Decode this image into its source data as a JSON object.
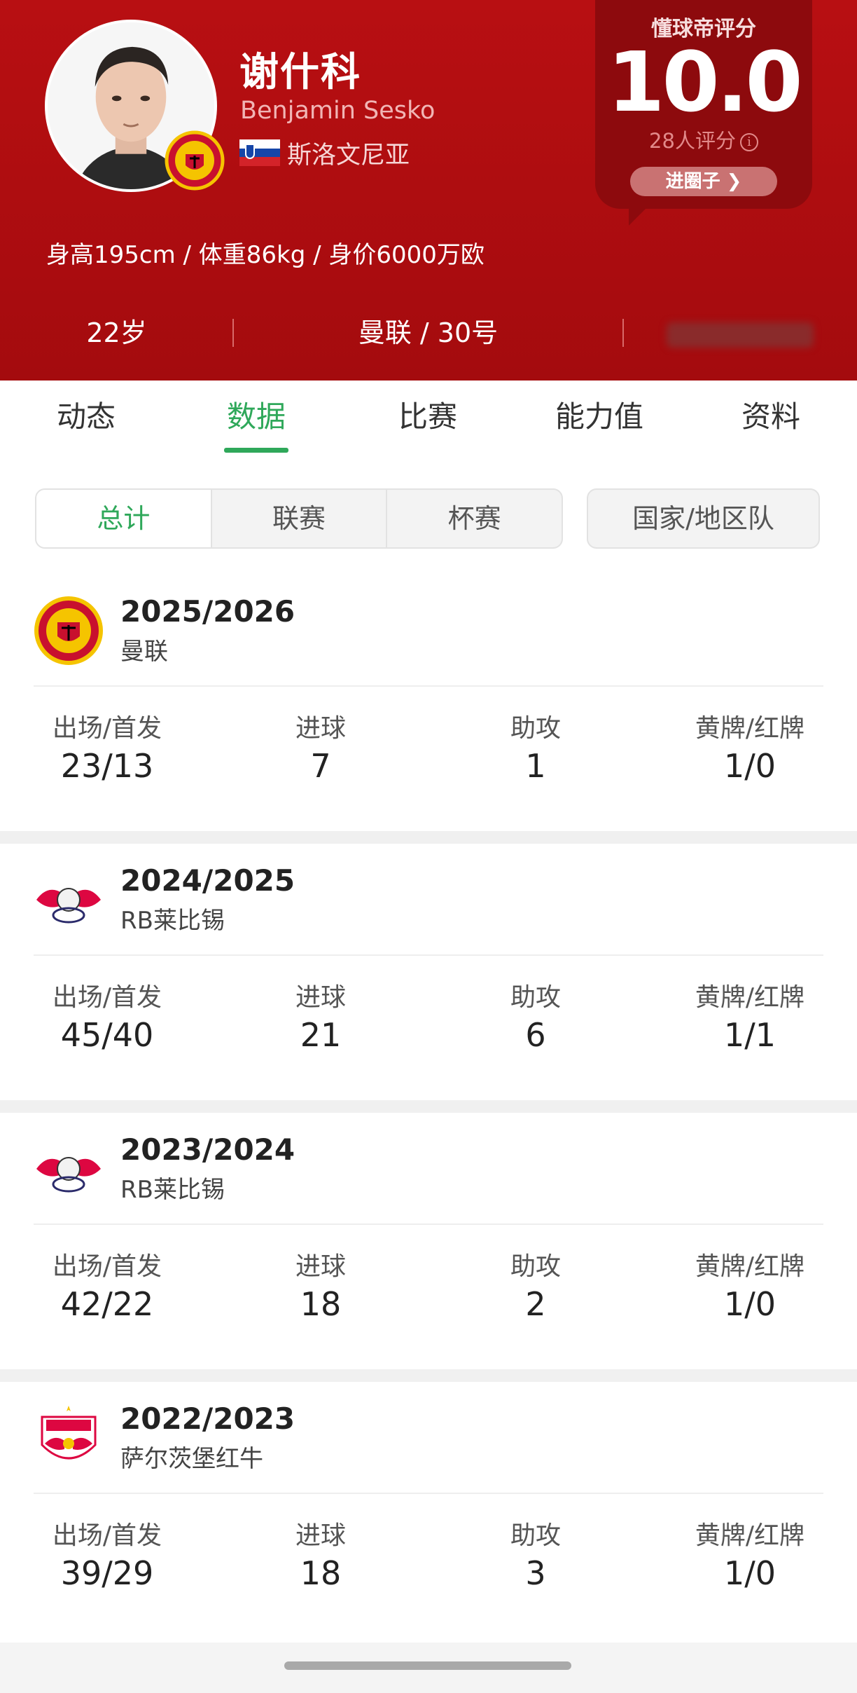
{
  "header": {
    "player_name": "谢什科",
    "player_name_en": "Benjamin Sesko",
    "nationality": "斯洛文尼亚",
    "body_stats": "身高195cm / 体重86kg / 身价6000万欧",
    "age": "22岁",
    "club_number": "曼联 / 30号",
    "rating": {
      "title": "懂球帝评分",
      "score": "10.0",
      "count": "28人评分",
      "info_icon": "i",
      "circle_button": "进圈子 ❯"
    },
    "colors": {
      "bg": "#b80f12",
      "card": "#8d0a0d"
    }
  },
  "tabs": [
    "动态",
    "数据",
    "比赛",
    "能力值",
    "资料"
  ],
  "active_tab": "数据",
  "filters": {
    "segments": [
      "总计",
      "联赛",
      "杯赛"
    ],
    "active": "总计",
    "national_team": "国家/地区队"
  },
  "stat_labels": [
    "出场/首发",
    "进球",
    "助攻",
    "黄牌/红牌"
  ],
  "seasons": [
    {
      "year": "2025/2026",
      "club": "曼联",
      "logo": "man-utd-crest",
      "values": [
        "23/13",
        "7",
        "1",
        "1/0"
      ]
    },
    {
      "year": "2024/2025",
      "club": "RB莱比锡",
      "logo": "rb-leipzig-crest",
      "values": [
        "45/40",
        "21",
        "6",
        "1/1"
      ]
    },
    {
      "year": "2023/2024",
      "club": "RB莱比锡",
      "logo": "rb-leipzig-crest",
      "values": [
        "42/22",
        "18",
        "2",
        "1/0"
      ]
    },
    {
      "year": "2022/2023",
      "club": "萨尔茨堡红牛",
      "logo": "rb-salzburg-crest",
      "values": [
        "39/29",
        "18",
        "3",
        "1/0"
      ]
    }
  ],
  "accent_color": "#2fa85a"
}
